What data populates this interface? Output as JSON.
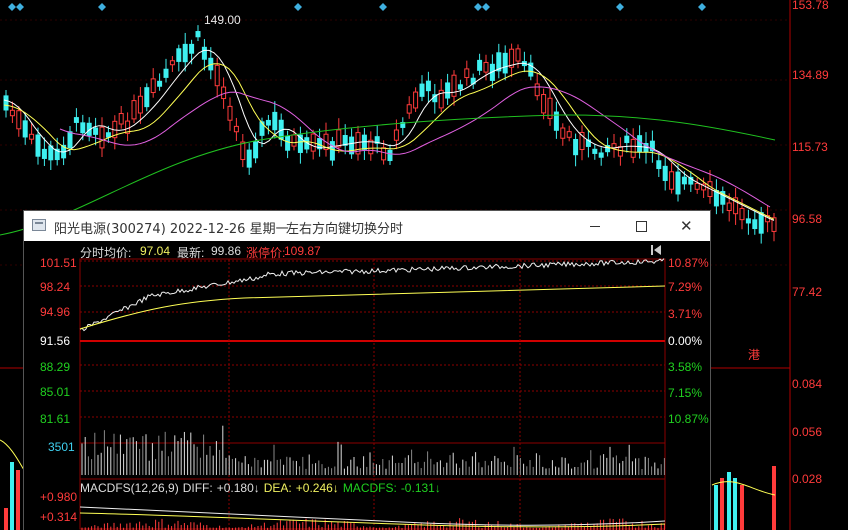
{
  "main_chart": {
    "right_axis_prices": [
      "153.78",
      "134.89",
      "115.73",
      "96.58",
      "77.42"
    ],
    "right_axis_lower": [
      "0.084",
      "0.056",
      "0.028"
    ],
    "peak_label": "149.00",
    "hk_marker": "港"
  },
  "window": {
    "title": "阳光电源(300274) 2022-12-26 星期一",
    "hint": "左右方向键切换分时",
    "info": {
      "mode_label": "分时",
      "avg_label": "均价:",
      "avg_value": "97.04",
      "latest_label": "最新:",
      "latest_value": "99.86",
      "limit_label": "涨停价:",
      "limit_value": "109.87"
    },
    "left_axis": [
      "101.51",
      "98.24",
      "94.96",
      "91.56",
      "88.29",
      "85.01",
      "81.61"
    ],
    "right_axis": [
      "10.87%",
      "7.29%",
      "3.71%",
      "0.00%",
      "3.58%",
      "7.15%",
      "10.87%"
    ],
    "volume_label": "3501",
    "macd": {
      "name": "MACDFS(12,26,9)",
      "diff_label": "DIFF:",
      "diff_value": "+0.180↓",
      "dea_label": "DEA:",
      "dea_value": "+0.246↓",
      "macd_label": "MACDFS:",
      "macd_value": "-0.131↓",
      "label_top": "+0.980",
      "label_mid": "+0.314"
    }
  },
  "colors": {
    "up": "#ff3b3b",
    "down": "#3ff0f0",
    "ma5": "#ffffff",
    "ma10": "#ffff55",
    "ma20": "#e060e0",
    "ma60": "#20c020",
    "grid": "#8b0000"
  },
  "icons": {
    "app": "window-app-icon",
    "back": "back-to-start-icon",
    "markers": "diamond-marker-icon"
  }
}
